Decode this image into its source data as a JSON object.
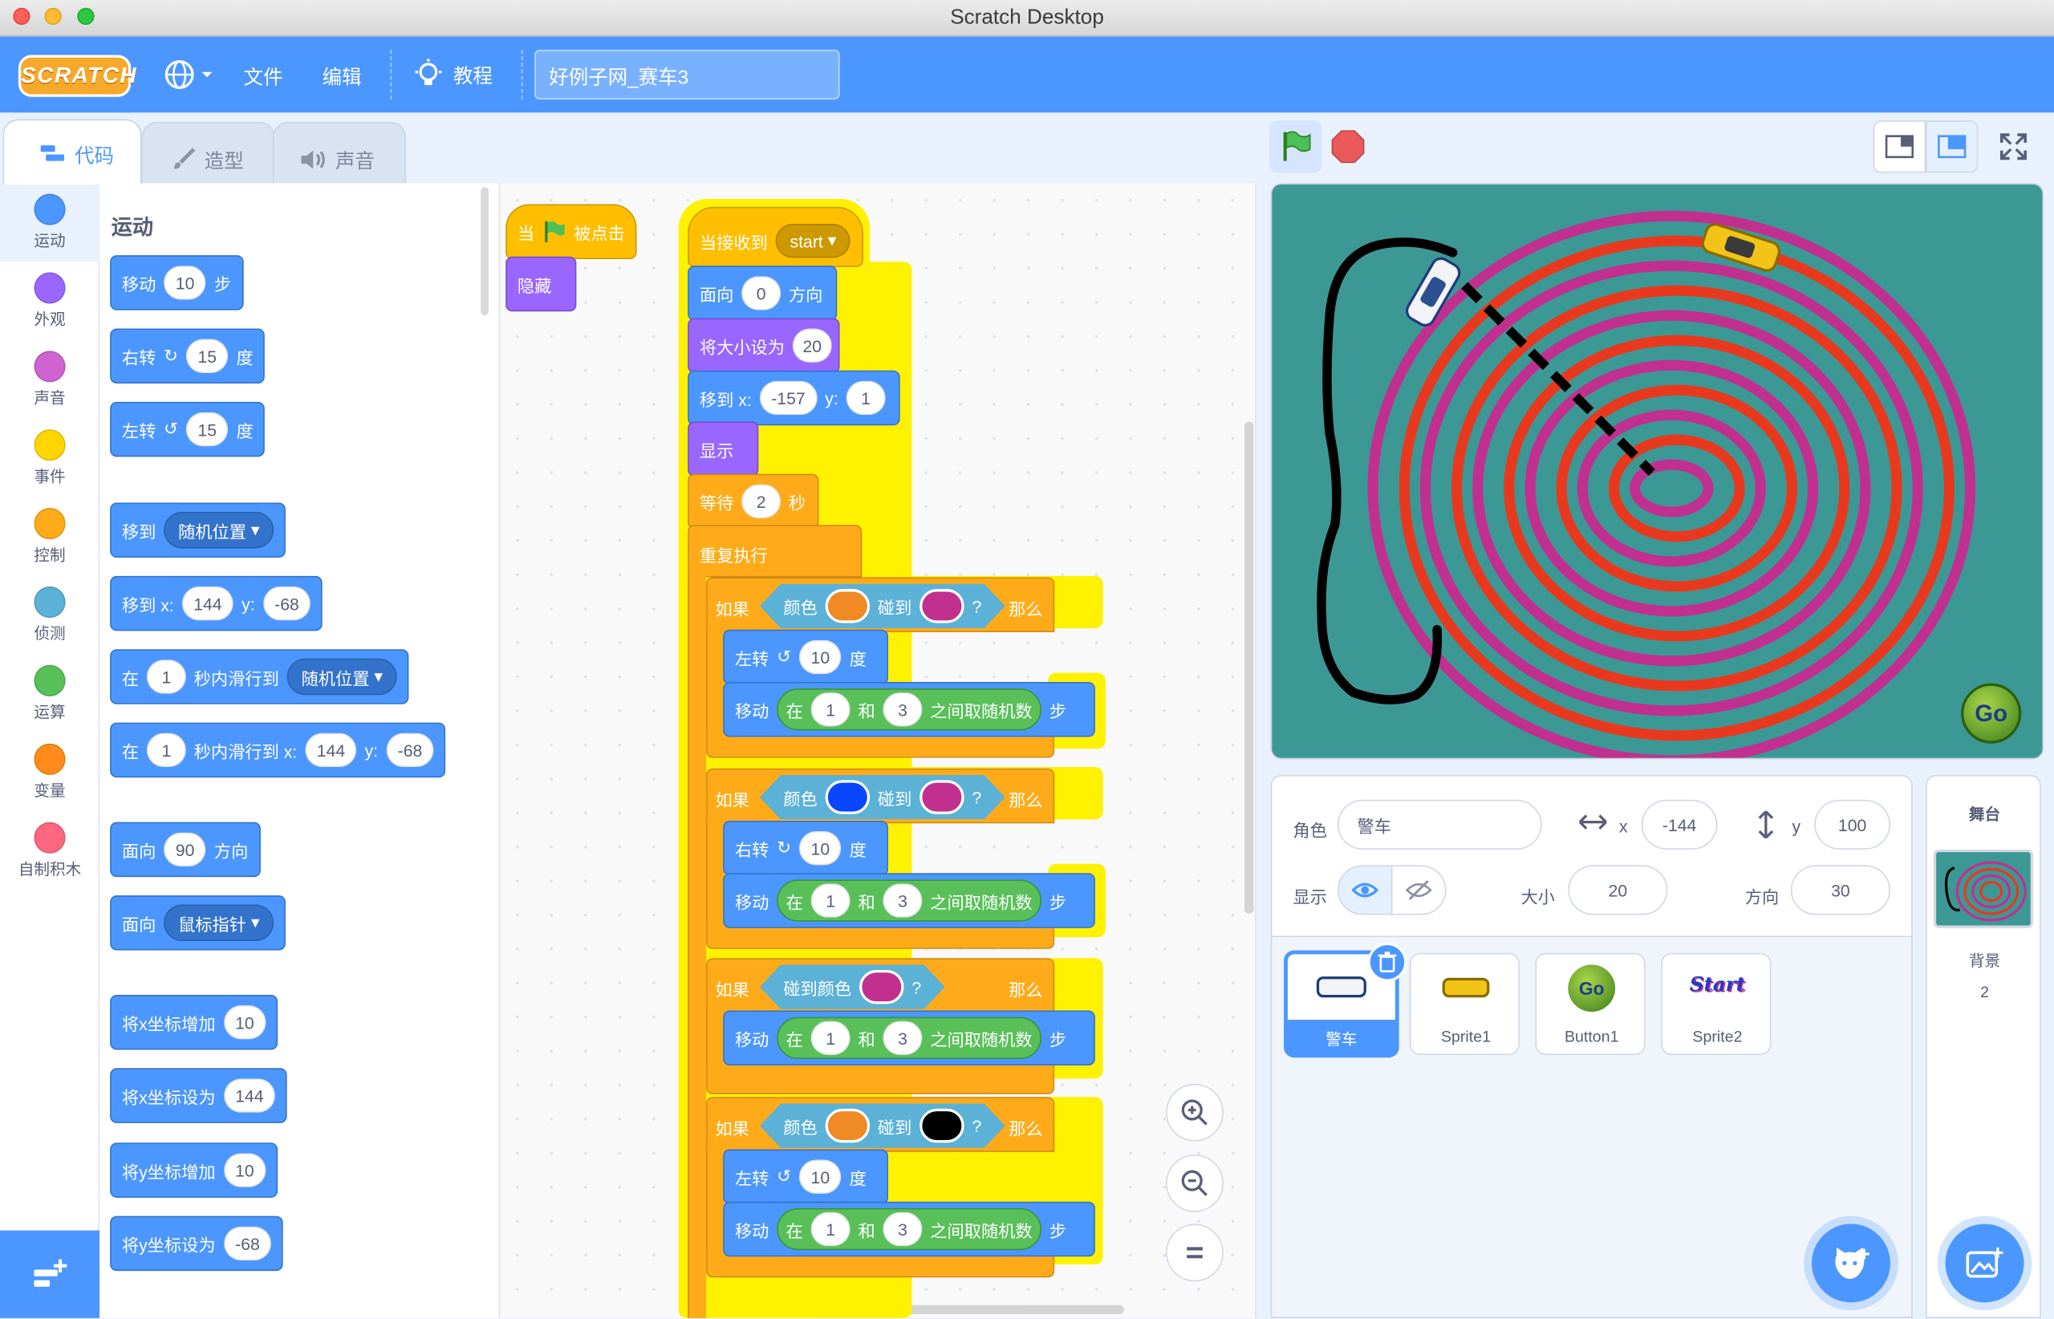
{
  "window": {
    "title": "Scratch Desktop"
  },
  "menu": {
    "logo": "SCRATCH",
    "file": "文件",
    "edit": "编辑",
    "tutorials": "教程",
    "project_name": "好例子网_赛车3"
  },
  "tabs": {
    "code": "代码",
    "costumes": "造型",
    "sounds": "声音"
  },
  "categories": [
    {
      "label": "运动",
      "color": "#4c97ff"
    },
    {
      "label": "外观",
      "color": "#9966ff"
    },
    {
      "label": "声音",
      "color": "#cf63cf"
    },
    {
      "label": "事件",
      "color": "#ffd500"
    },
    {
      "label": "控制",
      "color": "#ffab19"
    },
    {
      "label": "侦测",
      "color": "#5cb1d6"
    },
    {
      "label": "运算",
      "color": "#59c059"
    },
    {
      "label": "变量",
      "color": "#ff8c1a"
    },
    {
      "label": "自制积木",
      "color": "#ff6680"
    }
  ],
  "palette": {
    "title": "运动",
    "move": {
      "a": "移动",
      "v": "10",
      "b": "步"
    },
    "turn_right": {
      "a": "右转",
      "v": "15",
      "b": "度"
    },
    "turn_left": {
      "a": "左转",
      "v": "15",
      "b": "度"
    },
    "goto": {
      "a": "移到",
      "d": "随机位置"
    },
    "goto_xy": {
      "a": "移到 x:",
      "x": "144",
      "b": "y:",
      "y": "-68"
    },
    "glide": {
      "a": "在",
      "v": "1",
      "b": "秒内滑行到",
      "d": "随机位置"
    },
    "glide_xy": {
      "a": "在",
      "v": "1",
      "b": "秒内滑行到 x:",
      "x": "144",
      "c": "y:",
      "y": "-68"
    },
    "point": {
      "a": "面向",
      "v": "90",
      "b": "方向"
    },
    "point_to": {
      "a": "面向",
      "d": "鼠标指针"
    },
    "change_x": {
      "a": "将x坐标增加",
      "v": "10"
    },
    "set_x": {
      "a": "将x坐标设为",
      "v": "144"
    },
    "change_y": {
      "a": "将y坐标增加",
      "v": "10"
    },
    "set_y": {
      "a": "将y坐标设为",
      "v": "-68"
    }
  },
  "script1": {
    "hat_a": "当",
    "hat_b": "被点击",
    "hide": "隐藏"
  },
  "script2": {
    "hat": "当接收到",
    "msg": "start",
    "point": {
      "a": "面向",
      "v": "0",
      "b": "方向"
    },
    "size": {
      "a": "将大小设为",
      "v": "20"
    },
    "goto": {
      "a": "移到 x:",
      "x": "-157",
      "b": "y:",
      "y": "1"
    },
    "show": "显示",
    "wait": {
      "a": "等待",
      "v": "2",
      "b": "秒"
    },
    "forever": "重复执行",
    "if": "如果",
    "then": "那么",
    "color": "颜色",
    "touch": "碰到",
    "q": "?",
    "touch_color": "碰到颜色",
    "left": "左转",
    "right": "右转",
    "deg": "度",
    "ten": "10",
    "move": "移动",
    "steps": "步",
    "rand_a": "在",
    "rand_b": "和",
    "rand_c": "之间取随机数",
    "one": "1",
    "three": "3"
  },
  "sprite_info": {
    "sprite_label": "角色",
    "sprite_name": "警车",
    "x_label": "x",
    "x": "-144",
    "y_label": "y",
    "y": "100",
    "show_label": "显示",
    "size_label": "大小",
    "size": "20",
    "direction_label": "方向",
    "direction": "30"
  },
  "sprites": [
    {
      "name": "警车"
    },
    {
      "name": "Sprite1"
    },
    {
      "name": "Button1"
    },
    {
      "name": "Sprite2"
    }
  ],
  "stage_panel": {
    "title": "舞台",
    "backdrops_label": "背景",
    "backdrops_count": "2"
  },
  "stage": {
    "go_button": "Go",
    "start_text": "Start"
  },
  "colors": {
    "accent": "#4c97ff",
    "motion": "#4c97ff",
    "events": "#ffbf00",
    "control": "#ffab19",
    "sensing": "#5cb1d6",
    "operators": "#59c059",
    "looks": "#9966ff",
    "stage_bg": "#3c9895",
    "track_magenta": "#c1308f",
    "track_red": "#e8391f"
  }
}
